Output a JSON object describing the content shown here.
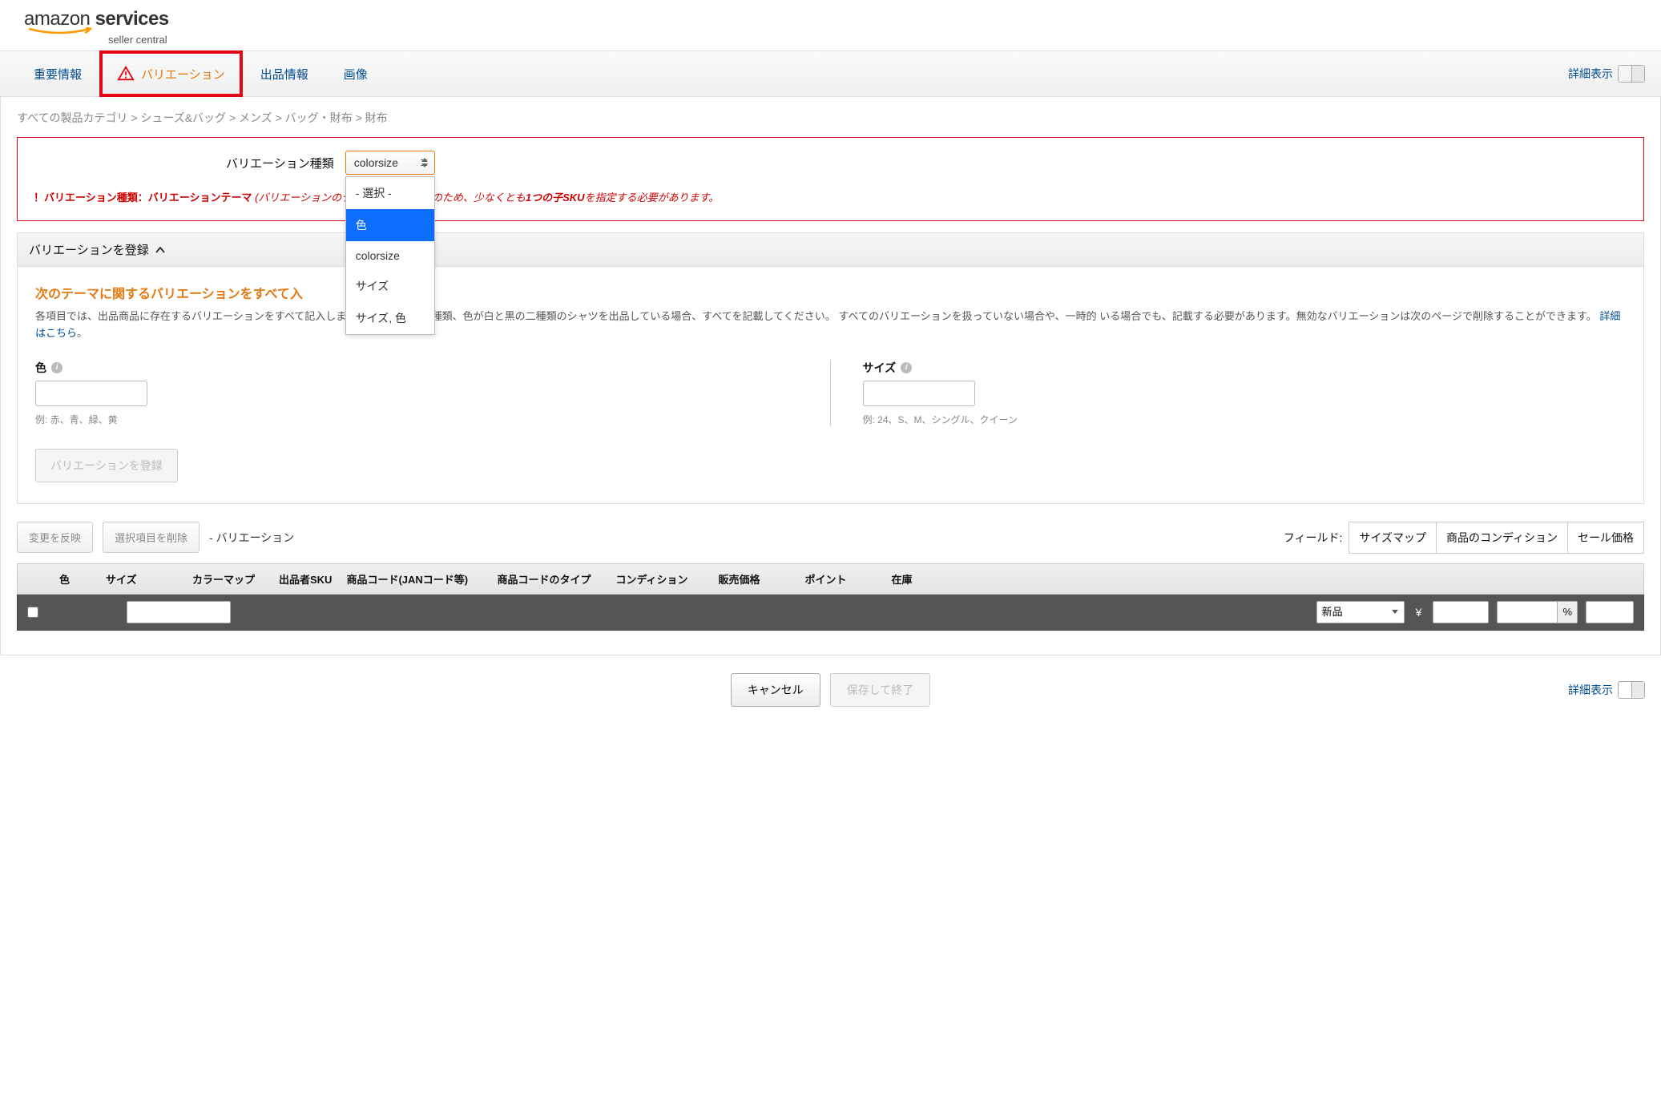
{
  "logo": {
    "top_plain": "amazon ",
    "top_bold": "services",
    "sub": "seller central"
  },
  "tabs": {
    "t1": "重要情報",
    "t2": "バリエーション",
    "t3": "出品情報",
    "t4": "画像"
  },
  "detail_toggle": "詳細表示",
  "breadcrumb": "すべての製品カテゴリ > シューズ&バッグ > メンズ > バッグ・財布 > 財布",
  "vt": {
    "label": "バリエーション種類",
    "selected": "colorsize",
    "options": [
      "- 選択 -",
      "色",
      "colorsize",
      "サイズ",
      "サイズ, 色"
    ],
    "selected_index": 1
  },
  "err": {
    "prefix": "！バリエーション種類：バリエーションテーマ ",
    "italic1": "(バリエーションのテー",
    "italic2": "のため、少なくとも",
    "sku": "1つの子SKU",
    "italic3": "を指定する必要があります。"
  },
  "section": {
    "head": "バリエーションを登録",
    "heading": "次のテーマに関するバリエーションをすべて入",
    "heading_rest": "。",
    "para": "各項目では、出品商品に存在するバリエーションをすべて記入します。た                                中、小の三種類、色が白と黒の二種類のシャツを出品している場合、すべてを記載してください。 すべてのバリエーションを扱っていない場合や、一時的                              いる場合でも、記載する必要があります。無効なバリエーションは次のページで削除することができます。 ",
    "link": "詳細はこちら",
    "link_dot": "。"
  },
  "fields": {
    "color": {
      "label": "色",
      "hint": "例: 赤、青、緑、黄"
    },
    "size": {
      "label": "サイズ",
      "hint": "例: 24、S、M、シングル、クイーン"
    }
  },
  "register_btn": "バリエーションを登録",
  "actions": {
    "apply": "変更を反映",
    "delete": "選択項目を削除",
    "dash": "- バリエーション",
    "field_prefix": "フィールド:",
    "tags": [
      "サイズマップ",
      "商品のコンディション",
      "セール価格"
    ]
  },
  "table": {
    "headers": [
      "",
      "色",
      "サイズ",
      "カラーマップ",
      "出品者SKU",
      "商品コード(JANコード等)",
      "商品コードのタイプ",
      "コンディション",
      "販売価格",
      "ポイント",
      "在庫"
    ],
    "cond_value": "新品",
    "yen": "¥",
    "pct": "%"
  },
  "footer": {
    "cancel": "キャンセル",
    "save": "保存して終了"
  }
}
